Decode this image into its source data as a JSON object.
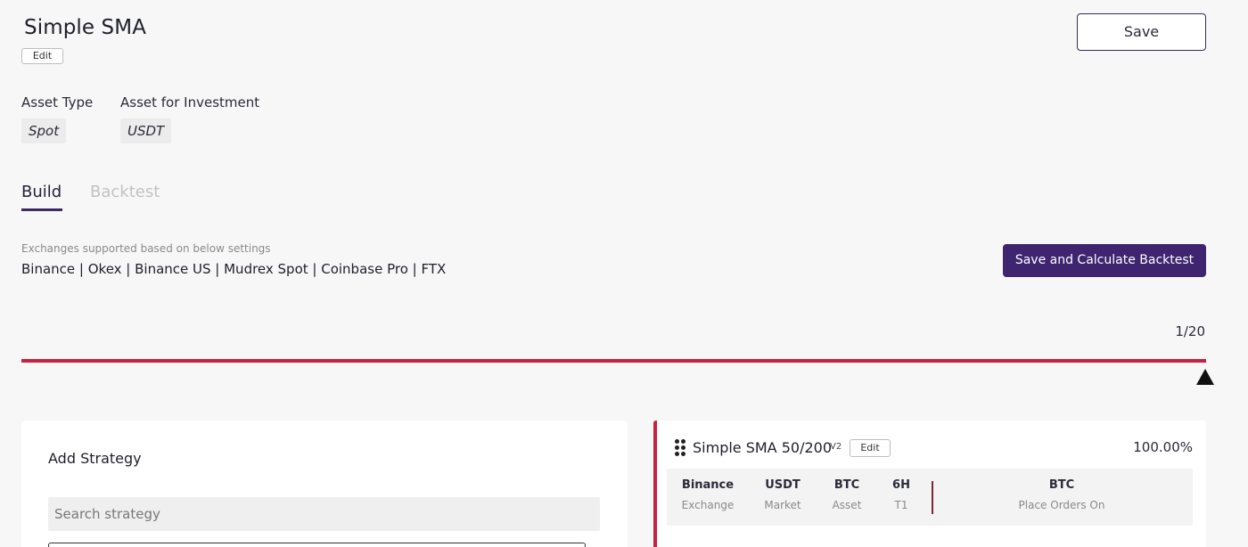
{
  "header": {
    "title": "Simple SMA",
    "edit_label": "Edit",
    "save_label": "Save"
  },
  "asset": {
    "type_label": "Asset Type",
    "type_value": "Spot",
    "investment_label": "Asset for Investment",
    "investment_value": "USDT"
  },
  "tabs": [
    {
      "label": "Build",
      "active": true
    },
    {
      "label": "Backtest",
      "active": false
    }
  ],
  "exchanges": {
    "caption": "Exchanges supported based on below settings",
    "list": "Binance | Okex | Binance US | Mudrex Spot | Coinbase Pro | FTX",
    "calc_button": "Save and Calculate Backtest"
  },
  "progress": {
    "count": "1/20",
    "fraction": 1.0
  },
  "add_strategy": {
    "title": "Add Strategy",
    "search_placeholder": "Search strategy"
  },
  "strategy_card": {
    "name": "Simple SMA 50/200",
    "version": "V2",
    "edit_label": "Edit",
    "percent": "100.00%",
    "stats": [
      {
        "value": "Binance",
        "label": "Exchange"
      },
      {
        "value": "USDT",
        "label": "Market"
      },
      {
        "value": "BTC",
        "label": "Asset"
      },
      {
        "value": "6H",
        "label": "T1"
      },
      {
        "value": "BTC",
        "label": "Place Orders On"
      }
    ]
  },
  "colors": {
    "accent": "#3f2470",
    "progress": "#c8203f"
  }
}
